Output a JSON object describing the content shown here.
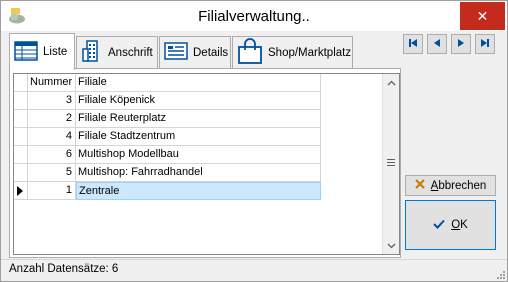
{
  "window": {
    "title": "Filialverwaltung..",
    "close_glyph": "✕"
  },
  "tabs": [
    {
      "label": "Liste",
      "icon": "list-grid-icon",
      "active": true
    },
    {
      "label": "Anschrift",
      "icon": "building-icon",
      "active": false
    },
    {
      "label": "Details",
      "icon": "details-card-icon",
      "active": false
    },
    {
      "label": "Shop/Marktplatz",
      "icon": "shopping-bag-icon",
      "active": false
    }
  ],
  "grid": {
    "columns": [
      "Nummer",
      "Filiale"
    ],
    "rows": [
      {
        "nummer": "3",
        "filiale": "Filiale Köpenick"
      },
      {
        "nummer": "2",
        "filiale": "Filiale Reuterplatz"
      },
      {
        "nummer": "4",
        "filiale": "Filiale Stadtzentrum"
      },
      {
        "nummer": "6",
        "filiale": "Multishop Modellbau"
      },
      {
        "nummer": "5",
        "filiale": "Multishop: Fahrradhandel"
      },
      {
        "nummer": "1",
        "filiale": "Zentrale"
      }
    ],
    "current_row_index": 5
  },
  "navigation": {
    "buttons": [
      "first-record-icon",
      "previous-record-icon",
      "next-record-icon",
      "last-record-icon"
    ]
  },
  "buttons": {
    "cancel_label_first": "A",
    "cancel_label_rest": "bbrechen",
    "ok_label_first": "O",
    "ok_label_rest": "K"
  },
  "status": {
    "text": "Anzahl Datensätze: 6"
  },
  "colors": {
    "accent": "#0078d7",
    "selection": "#cce8ff",
    "close": "#c42b1c",
    "nav_icon": "#0050a0"
  }
}
